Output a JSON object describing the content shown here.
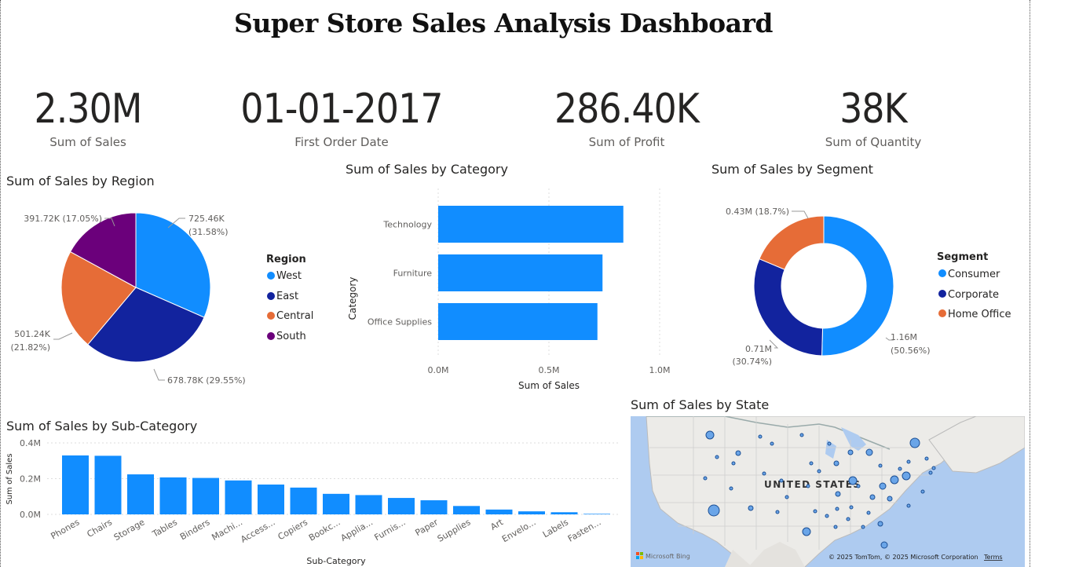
{
  "title": "Super Store Sales Analysis Dashboard",
  "kpis": [
    {
      "value": "2.30M",
      "label": "Sum of Sales"
    },
    {
      "value": "01-01-2017",
      "label": "First Order Date"
    },
    {
      "value": "286.40K",
      "label": "Sum of Profit"
    },
    {
      "value": "38K",
      "label": "Sum of Quantity"
    }
  ],
  "colors": {
    "blue": "#118DFF",
    "navy": "#12239E",
    "orange": "#E66C37",
    "purple": "#6B007B"
  },
  "region": {
    "title": "Sum of Sales by Region",
    "legend_title": "Region",
    "legend": [
      "West",
      "East",
      "Central",
      "South"
    ],
    "labels": [
      "725.46K",
      "(31.58%)",
      "678.78K (29.55%)",
      "501.24K",
      "(21.82%)",
      "391.72K (17.05%)"
    ]
  },
  "category": {
    "title": "Sum of Sales by Category",
    "ylabel": "Category",
    "xlabel": "Sum of Sales",
    "ticks": [
      "0.0M",
      "0.5M",
      "1.0M"
    ]
  },
  "segment": {
    "title": "Sum of Sales by Segment",
    "legend_title": "Segment",
    "legend": [
      "Consumer",
      "Corporate",
      "Home Office"
    ],
    "labels": [
      "1.16M",
      "(50.56%)",
      "0.71M",
      "(30.74%)",
      "0.43M (18.7%)"
    ]
  },
  "subcategory": {
    "title": "Sum of Sales by Sub-Category",
    "ylabel": "Sum of Sales",
    "xlabel": "Sub-Category",
    "yticks": [
      "0.4M",
      "0.2M",
      "0.0M"
    ]
  },
  "state": {
    "title": "Sum of Sales by State",
    "country_label": "UNITED STATES",
    "bing": "Microsoft Bing",
    "copyright": "© 2025 TomTom, © 2025 Microsoft Corporation",
    "terms": "Terms"
  },
  "chart_data": [
    {
      "type": "pie",
      "title": "Sum of Sales by Region",
      "categories": [
        "West",
        "East",
        "Central",
        "South"
      ],
      "values": [
        725.46,
        678.78,
        501.24,
        391.72
      ],
      "unit": "K"
    },
    {
      "type": "bar",
      "orientation": "horizontal",
      "title": "Sum of Sales by Category",
      "categories": [
        "Technology",
        "Furniture",
        "Office Supplies"
      ],
      "values": [
        0.836,
        0.742,
        0.719
      ],
      "xlabel": "Sum of Sales",
      "ylabel": "Category",
      "xlim": [
        0,
        1.0
      ]
    },
    {
      "type": "pie",
      "title": "Sum of Sales by Segment",
      "categories": [
        "Consumer",
        "Corporate",
        "Home Office"
      ],
      "values": [
        1.16,
        0.71,
        0.43
      ],
      "unit": "M"
    },
    {
      "type": "bar",
      "title": "Sum of Sales by Sub-Category",
      "categories": [
        "Phones",
        "Chairs",
        "Storage",
        "Tables",
        "Binders",
        "Machi...",
        "Access...",
        "Copiers",
        "Bookc...",
        "Applia...",
        "Furnis...",
        "Paper",
        "Supplies",
        "Art",
        "Envelo...",
        "Labels",
        "Fasten..."
      ],
      "values": [
        0.33,
        0.328,
        0.224,
        0.207,
        0.204,
        0.19,
        0.167,
        0.15,
        0.115,
        0.108,
        0.092,
        0.079,
        0.047,
        0.027,
        0.017,
        0.012,
        0.003
      ],
      "xlabel": "Sub-Category",
      "ylabel": "Sum of Sales",
      "ylim": [
        0,
        0.4
      ]
    }
  ]
}
